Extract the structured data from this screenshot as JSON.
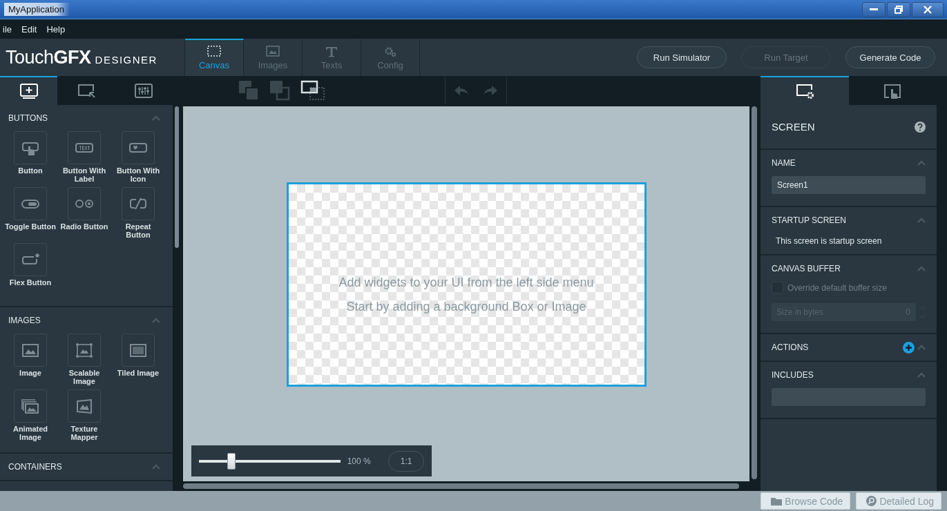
{
  "window": {
    "title": "MyApplication"
  },
  "menu": [
    {
      "label": "ile"
    },
    {
      "label": "Edit"
    },
    {
      "label": "Help"
    }
  ],
  "logo": {
    "name": "Touch**GFX**",
    "subtitle": "DESIGNER"
  },
  "main_tabs": [
    {
      "label": "Canvas",
      "kind": "canvas",
      "selected": true
    },
    {
      "label": "Images",
      "kind": "images",
      "selected": false
    },
    {
      "label": "Texts",
      "kind": "texts",
      "selected": false
    },
    {
      "label": "Config",
      "kind": "config",
      "selected": false
    }
  ],
  "actions": [
    {
      "label": "Run Simulator",
      "disabled": false
    },
    {
      "label": "Run Target",
      "disabled": true
    },
    {
      "label": "Generate Code",
      "disabled": false
    }
  ],
  "left_tabs": [
    {
      "kind": "add",
      "selected": true
    },
    {
      "kind": "select",
      "selected": false
    },
    {
      "kind": "properties",
      "selected": false
    }
  ],
  "widget_groups": [
    {
      "title": "BUTTONS",
      "expanded": true,
      "items": [
        {
          "label": "Button",
          "kind": "button"
        },
        {
          "label": "Button With Label",
          "kind": "label"
        },
        {
          "label": "Button With Icon",
          "kind": "icon"
        },
        {
          "label": "Toggle Button",
          "kind": "toggle"
        },
        {
          "label": "Radio Button",
          "kind": "radio"
        },
        {
          "label": "Repeat Button",
          "kind": "repeat"
        },
        {
          "label": "Flex Button",
          "kind": "flex"
        }
      ]
    },
    {
      "title": "IMAGES",
      "expanded": true,
      "items": [
        {
          "label": "Image",
          "kind": "image"
        },
        {
          "label": "Scalable Image",
          "kind": "scalable"
        },
        {
          "label": "Tiled Image",
          "kind": "tiled"
        },
        {
          "label": "Animated Image",
          "kind": "animated"
        },
        {
          "label": "Texture Mapper",
          "kind": "texture"
        }
      ]
    },
    {
      "title": "CONTAINERS",
      "expanded": true
    }
  ],
  "canvas": {
    "hint_lines": [
      "Add widgets to your UI from the left side menu",
      "Start by adding a background Box or Image"
    ],
    "zoom": {
      "level": 0.23,
      "reading": "100 %",
      "fit_label": "1:1"
    }
  },
  "right_tabs": [
    {
      "kind": "screen",
      "selected": true
    },
    {
      "kind": "interaction",
      "selected": false
    }
  ],
  "properties": {
    "title": "SCREEN",
    "sections": [
      {
        "kind": "name",
        "title": "NAME",
        "expanded": true,
        "value": "Screen1"
      },
      {
        "kind": "text",
        "title": "STARTUP SCREEN",
        "expanded": true,
        "text": "This screen is startup screen"
      },
      {
        "kind": "buffer",
        "title": "CANVAS BUFFER",
        "expanded": true,
        "checkbox": {
          "label": "Override default buffer size",
          "checked": false
        },
        "field": {
          "label": "Size in bytes",
          "value": "0",
          "disabled": true
        }
      },
      {
        "kind": "actions",
        "title": "ACTIONS",
        "expanded": true
      },
      {
        "kind": "includes",
        "title": "INCLUDES",
        "expanded": true
      }
    ]
  },
  "status_bar": {
    "buttons": [
      {
        "label": "Browse Code",
        "kind": "folder"
      },
      {
        "label": "Detailed Log",
        "kind": "log"
      }
    ]
  }
}
